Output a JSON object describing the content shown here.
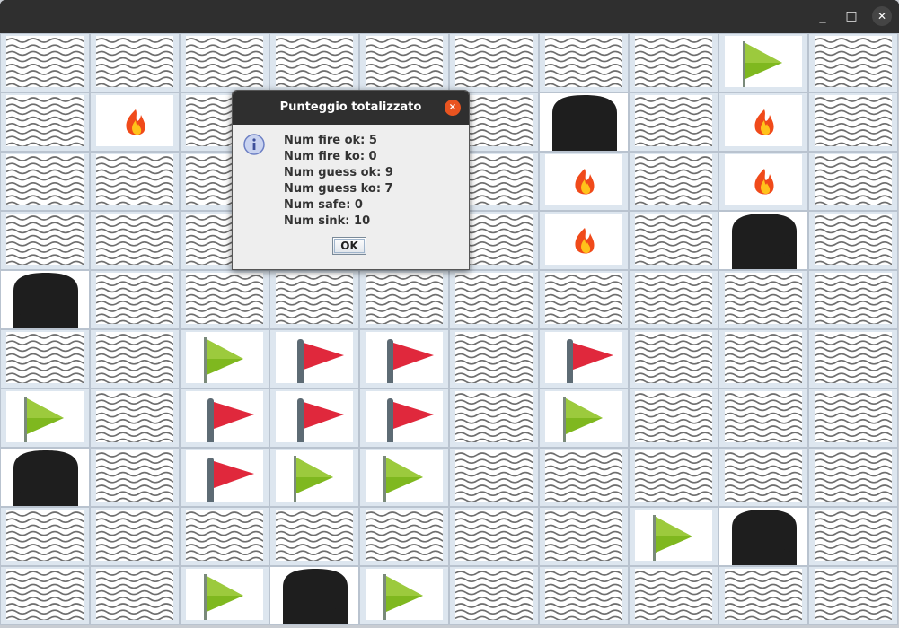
{
  "window": {
    "controls": {
      "minimize": "_",
      "maximize": "□",
      "close": "✕"
    }
  },
  "board": {
    "rows": 10,
    "cols": 10,
    "cells": [
      [
        "water",
        "water",
        "water",
        "water",
        "water",
        "water",
        "water",
        "water",
        "flag-green",
        "water"
      ],
      [
        "water",
        "fire",
        "water",
        "water",
        "water",
        "water",
        "sunk",
        "water",
        "fire",
        "water"
      ],
      [
        "water",
        "water",
        "water",
        "water",
        "water",
        "water",
        "fire",
        "water",
        "fire",
        "water"
      ],
      [
        "water",
        "water",
        "water",
        "water",
        "water",
        "water",
        "fire",
        "water",
        "sunk",
        "water"
      ],
      [
        "sunk",
        "water",
        "water",
        "water",
        "water",
        "water",
        "water",
        "water",
        "water",
        "water"
      ],
      [
        "water",
        "water",
        "flag-green",
        "flag-red",
        "flag-red",
        "water",
        "flag-red",
        "water",
        "water",
        "water"
      ],
      [
        "flag-green",
        "water",
        "flag-red",
        "flag-red",
        "flag-red",
        "water",
        "flag-green",
        "water",
        "water",
        "water"
      ],
      [
        "sunk",
        "water",
        "flag-red",
        "flag-green",
        "flag-green",
        "water",
        "water",
        "water",
        "water",
        "water"
      ],
      [
        "water",
        "water",
        "water",
        "water",
        "water",
        "water",
        "water",
        "flag-green",
        "sunk",
        "water"
      ],
      [
        "water",
        "water",
        "flag-green",
        "sunk",
        "flag-green",
        "water",
        "water",
        "water",
        "water",
        "water"
      ]
    ],
    "icons": {
      "water": "wave-pattern-icon",
      "fire": "fire-icon",
      "flag-green": "green-flag-icon",
      "flag-red": "red-flag-icon",
      "sunk": "sunk-hole-icon"
    },
    "colors": {
      "red_flag": "#e0283c",
      "green_flag": "#7fb81f",
      "fire": "#f04a1a",
      "sunk": "#1e1e1e",
      "sunk_border": "#e00000"
    }
  },
  "dialog": {
    "title": "Punteggio totalizzato",
    "close_icon": "×",
    "icon": "info-icon",
    "lines": [
      "Num fire ok: 5",
      "Num fire ko: 0",
      "Num guess ok: 9",
      "Num guess ko: 7",
      "Num safe: 0",
      "Num sink: 10"
    ],
    "ok_label": "OK"
  }
}
